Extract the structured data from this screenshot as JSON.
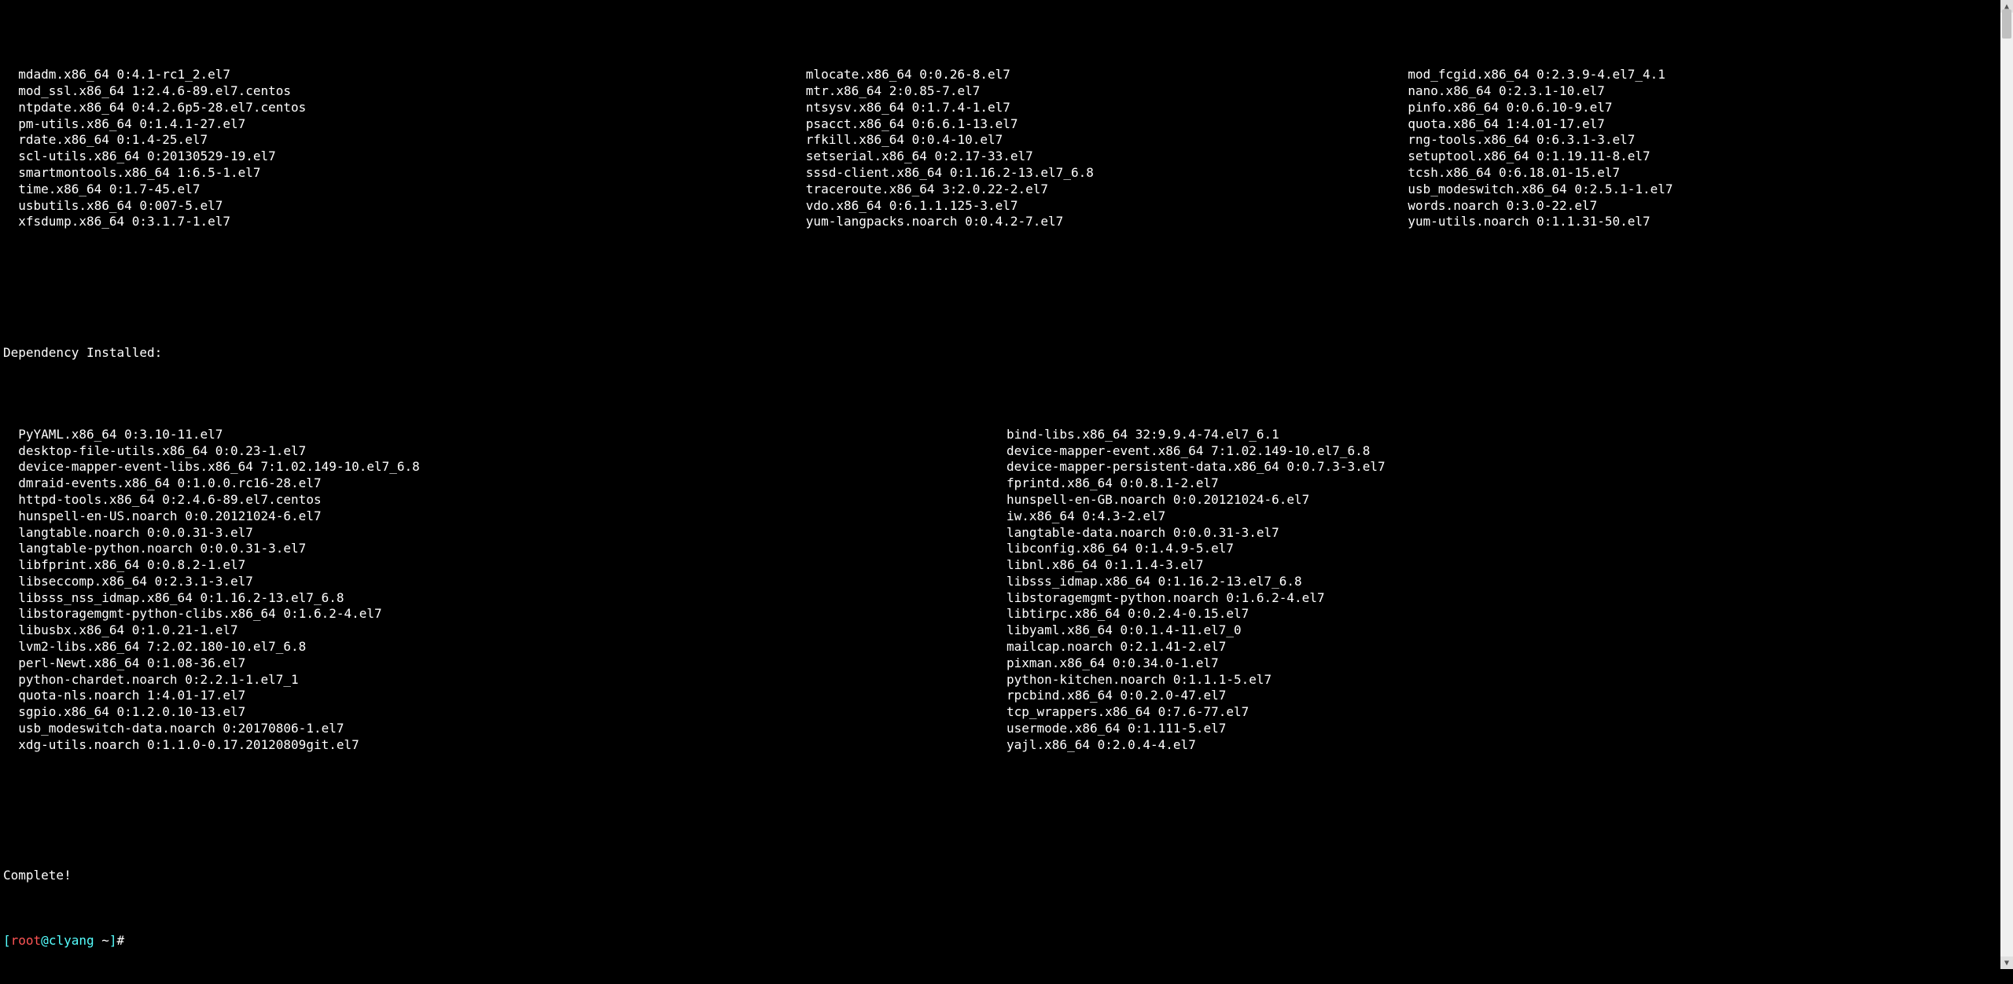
{
  "installed_packages": {
    "columns": [
      [
        "mdadm.x86_64 0:4.1-rc1_2.el7",
        "mod_ssl.x86_64 1:2.4.6-89.el7.centos",
        "ntpdate.x86_64 0:4.2.6p5-28.el7.centos",
        "pm-utils.x86_64 0:1.4.1-27.el7",
        "rdate.x86_64 0:1.4-25.el7",
        "scl-utils.x86_64 0:20130529-19.el7",
        "smartmontools.x86_64 1:6.5-1.el7",
        "time.x86_64 0:1.7-45.el7",
        "usbutils.x86_64 0:007-5.el7",
        "xfsdump.x86_64 0:3.1.7-1.el7"
      ],
      [
        "mlocate.x86_64 0:0.26-8.el7",
        "mtr.x86_64 2:0.85-7.el7",
        "ntsysv.x86_64 0:1.7.4-1.el7",
        "psacct.x86_64 0:6.6.1-13.el7",
        "rfkill.x86_64 0:0.4-10.el7",
        "setserial.x86_64 0:2.17-33.el7",
        "sssd-client.x86_64 0:1.16.2-13.el7_6.8",
        "traceroute.x86_64 3:2.0.22-2.el7",
        "vdo.x86_64 0:6.1.1.125-3.el7",
        "yum-langpacks.noarch 0:0.4.2-7.el7"
      ],
      [
        "mod_fcgid.x86_64 0:2.3.9-4.el7_4.1",
        "nano.x86_64 0:2.3.1-10.el7",
        "pinfo.x86_64 0:0.6.10-9.el7",
        "quota.x86_64 1:4.01-17.el7",
        "rng-tools.x86_64 0:6.3.1-3.el7",
        "setuptool.x86_64 0:1.19.11-8.el7",
        "tcsh.x86_64 0:6.18.01-15.el7",
        "usb_modeswitch.x86_64 0:2.5.1-1.el7",
        "words.noarch 0:3.0-22.el7",
        "yum-utils.noarch 0:1.1.31-50.el7"
      ]
    ]
  },
  "dependency_section_header": "Dependency Installed:",
  "dependency_packages": {
    "columns": [
      [
        "PyYAML.x86_64 0:3.10-11.el7",
        "desktop-file-utils.x86_64 0:0.23-1.el7",
        "device-mapper-event-libs.x86_64 7:1.02.149-10.el7_6.8",
        "dmraid-events.x86_64 0:1.0.0.rc16-28.el7",
        "httpd-tools.x86_64 0:2.4.6-89.el7.centos",
        "hunspell-en-US.noarch 0:0.20121024-6.el7",
        "langtable.noarch 0:0.0.31-3.el7",
        "langtable-python.noarch 0:0.0.31-3.el7",
        "libfprint.x86_64 0:0.8.2-1.el7",
        "libseccomp.x86_64 0:2.3.1-3.el7",
        "libsss_nss_idmap.x86_64 0:1.16.2-13.el7_6.8",
        "libstoragemgmt-python-clibs.x86_64 0:1.6.2-4.el7",
        "libusbx.x86_64 0:1.0.21-1.el7",
        "lvm2-libs.x86_64 7:2.02.180-10.el7_6.8",
        "perl-Newt.x86_64 0:1.08-36.el7",
        "python-chardet.noarch 0:2.2.1-1.el7_1",
        "quota-nls.noarch 1:4.01-17.el7",
        "sgpio.x86_64 0:1.2.0.10-13.el7",
        "usb_modeswitch-data.noarch 0:20170806-1.el7",
        "xdg-utils.noarch 0:1.1.0-0.17.20120809git.el7"
      ],
      [
        "bind-libs.x86_64 32:9.9.4-74.el7_6.1",
        "device-mapper-event.x86_64 7:1.02.149-10.el7_6.8",
        "device-mapper-persistent-data.x86_64 0:0.7.3-3.el7",
        "fprintd.x86_64 0:0.8.1-2.el7",
        "hunspell-en-GB.noarch 0:0.20121024-6.el7",
        "iw.x86_64 0:4.3-2.el7",
        "langtable-data.noarch 0:0.0.31-3.el7",
        "libconfig.x86_64 0:1.4.9-5.el7",
        "libnl.x86_64 0:1.1.4-3.el7",
        "libsss_idmap.x86_64 0:1.16.2-13.el7_6.8",
        "libstoragemgmt-python.noarch 0:1.6.2-4.el7",
        "libtirpc.x86_64 0:0.2.4-0.15.el7",
        "libyaml.x86_64 0:0.1.4-11.el7_0",
        "mailcap.noarch 0:2.1.41-2.el7",
        "pixman.x86_64 0:0.34.0-1.el7",
        "python-kitchen.noarch 0:1.1.1-5.el7",
        "rpcbind.x86_64 0:0.2.0-47.el7",
        "tcp_wrappers.x86_64 0:7.6-77.el7",
        "usermode.x86_64 0:1.111-5.el7",
        "yajl.x86_64 0:2.0.4-4.el7"
      ]
    ]
  },
  "complete_msg": "Complete!",
  "prompt": {
    "open": "[",
    "user": "root",
    "at": "@",
    "host": "clyang",
    "path": " ~",
    "close": "]",
    "hash": "# "
  },
  "scrollbar": {
    "thumb_top_pct": 1,
    "thumb_height_pct": 3
  }
}
